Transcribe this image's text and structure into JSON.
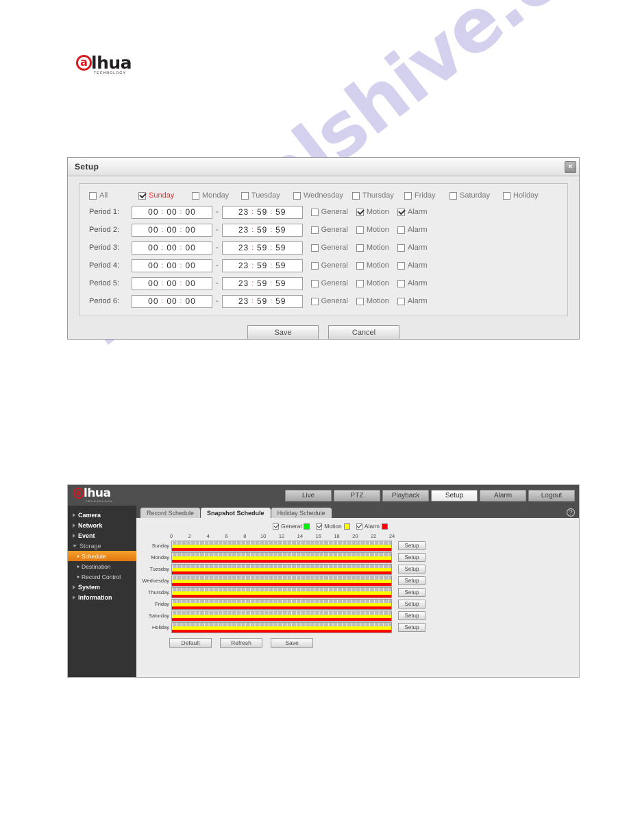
{
  "watermark": {
    "text": "manualshive.com"
  },
  "logo": {
    "mark": "a",
    "word": "lhua",
    "sub": "TECHNOLOGY"
  },
  "dialog": {
    "title": "Setup",
    "close_label": "×",
    "day_checkboxes": [
      {
        "label": "All",
        "checked": false,
        "selected": false
      },
      {
        "label": "Sunday",
        "checked": true,
        "selected": true
      },
      {
        "label": "Monday",
        "checked": false,
        "selected": false
      },
      {
        "label": "Tuesday",
        "checked": false,
        "selected": false
      },
      {
        "label": "Wednesday",
        "checked": false,
        "selected": false
      },
      {
        "label": "Thursday",
        "checked": false,
        "selected": false
      },
      {
        "label": "Friday",
        "checked": false,
        "selected": false
      },
      {
        "label": "Saturday",
        "checked": false,
        "selected": false
      },
      {
        "label": "Holiday",
        "checked": false,
        "selected": false
      }
    ],
    "separator": ":",
    "range_dash": "-",
    "periods": [
      {
        "label": "Period 1:",
        "start": [
          "00",
          "00",
          "00"
        ],
        "end": [
          "23",
          "59",
          "59"
        ],
        "events": [
          {
            "label": "General",
            "checked": false
          },
          {
            "label": "Motion",
            "checked": true
          },
          {
            "label": "Alarm",
            "checked": true
          }
        ]
      },
      {
        "label": "Period 2:",
        "start": [
          "00",
          "00",
          "00"
        ],
        "end": [
          "23",
          "59",
          "59"
        ],
        "events": [
          {
            "label": "General",
            "checked": false
          },
          {
            "label": "Motion",
            "checked": false
          },
          {
            "label": "Alarm",
            "checked": false
          }
        ]
      },
      {
        "label": "Period 3:",
        "start": [
          "00",
          "00",
          "00"
        ],
        "end": [
          "23",
          "59",
          "59"
        ],
        "events": [
          {
            "label": "General",
            "checked": false
          },
          {
            "label": "Motion",
            "checked": false
          },
          {
            "label": "Alarm",
            "checked": false
          }
        ]
      },
      {
        "label": "Period 4:",
        "start": [
          "00",
          "00",
          "00"
        ],
        "end": [
          "23",
          "59",
          "59"
        ],
        "events": [
          {
            "label": "General",
            "checked": false
          },
          {
            "label": "Motion",
            "checked": false
          },
          {
            "label": "Alarm",
            "checked": false
          }
        ]
      },
      {
        "label": "Period 5:",
        "start": [
          "00",
          "00",
          "00"
        ],
        "end": [
          "23",
          "59",
          "59"
        ],
        "events": [
          {
            "label": "General",
            "checked": false
          },
          {
            "label": "Motion",
            "checked": false
          },
          {
            "label": "Alarm",
            "checked": false
          }
        ]
      },
      {
        "label": "Period 6:",
        "start": [
          "00",
          "00",
          "00"
        ],
        "end": [
          "23",
          "59",
          "59"
        ],
        "events": [
          {
            "label": "General",
            "checked": false
          },
          {
            "label": "Motion",
            "checked": false
          },
          {
            "label": "Alarm",
            "checked": false
          }
        ]
      }
    ],
    "save_label": "Save",
    "cancel_label": "Cancel"
  },
  "webui": {
    "nav": [
      {
        "label": "Live",
        "active": false
      },
      {
        "label": "PTZ",
        "active": false
      },
      {
        "label": "Playback",
        "active": false
      },
      {
        "label": "Setup",
        "active": true
      },
      {
        "label": "Alarm",
        "active": false
      },
      {
        "label": "Logout",
        "active": false
      }
    ],
    "help_label": "?",
    "sidebar": [
      {
        "label": "Camera",
        "level": "top",
        "open": false,
        "active": false
      },
      {
        "label": "Network",
        "level": "top",
        "open": false,
        "active": false
      },
      {
        "label": "Event",
        "level": "top",
        "open": false,
        "active": false
      },
      {
        "label": "Storage",
        "level": "top",
        "open": true,
        "active": false,
        "dim": true
      },
      {
        "label": "Schedule",
        "level": "sub",
        "open": false,
        "active": true
      },
      {
        "label": "Destination",
        "level": "sub",
        "open": false,
        "active": false
      },
      {
        "label": "Record Control",
        "level": "sub",
        "open": false,
        "active": false
      },
      {
        "label": "System",
        "level": "top",
        "open": false,
        "active": false
      },
      {
        "label": "Information",
        "level": "top",
        "open": false,
        "active": false
      }
    ],
    "tabs": [
      {
        "label": "Record Schedule",
        "active": false
      },
      {
        "label": "Snapshot Schedule",
        "active": true
      },
      {
        "label": "Holiday Schedule",
        "active": false
      }
    ],
    "legend": [
      {
        "label": "General",
        "checked": true,
        "color": "#00ef00"
      },
      {
        "label": "Motion",
        "checked": true,
        "color": "#ffff00"
      },
      {
        "label": "Alarm",
        "checked": true,
        "color": "#ff0000"
      }
    ],
    "axis_ticks": [
      "0",
      "2",
      "4",
      "6",
      "8",
      "10",
      "12",
      "14",
      "16",
      "18",
      "20",
      "22",
      "24"
    ],
    "rows": [
      {
        "day": "Sunday",
        "setup_label": "Setup"
      },
      {
        "day": "Monday",
        "setup_label": "Setup"
      },
      {
        "day": "Tuesday",
        "setup_label": "Setup"
      },
      {
        "day": "Wednesday",
        "setup_label": "Setup"
      },
      {
        "day": "Thursday",
        "setup_label": "Setup"
      },
      {
        "day": "Friday",
        "setup_label": "Setup"
      },
      {
        "day": "Saturday",
        "setup_label": "Setup"
      },
      {
        "day": "Holiday",
        "setup_label": "Setup"
      }
    ],
    "actions": [
      {
        "label": "Default"
      },
      {
        "label": "Refresh"
      },
      {
        "label": "Save"
      }
    ]
  }
}
